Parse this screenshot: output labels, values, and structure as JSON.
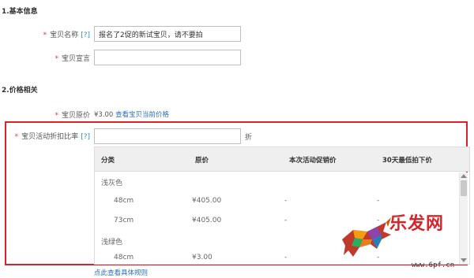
{
  "section1": {
    "title": "1.基本信息"
  },
  "fields": {
    "name": {
      "label": "宝贝名称",
      "help": "[?]",
      "value": "报名了2促的新试宝贝，请不要拍"
    },
    "slogan": {
      "label": "宝贝宣言",
      "value": ""
    }
  },
  "section2": {
    "title": "2.价格相关"
  },
  "price": {
    "label": "宝贝原价",
    "value": "¥3.00",
    "link": "查看宝贝当前价格"
  },
  "discount": {
    "label": "宝贝活动折扣比率",
    "help": "[?]",
    "value": "",
    "unit": "折"
  },
  "table": {
    "headers": [
      "分类",
      "原价",
      "本次活动促销价",
      "30天最低拍下价"
    ],
    "groups": [
      {
        "name": "浅灰色",
        "rows": [
          {
            "size": "48cm",
            "price": "¥405.00",
            "promo": "-",
            "low": "-"
          },
          {
            "size": "73cm",
            "price": "¥405.00",
            "promo": "-",
            "low": "-"
          }
        ]
      },
      {
        "name": "浅绿色",
        "rows": [
          {
            "size": "48cm",
            "price": "¥3.00",
            "promo": "-",
            "low": "-"
          }
        ]
      }
    ]
  },
  "rules_link": "点此查看具体规则",
  "required_mark": "*",
  "watermark": {
    "text": "乐发网",
    "url": "www.6pf.cn"
  },
  "colors": {
    "required": "#e4393c",
    "link": "#2a6fb8",
    "highlight_border": "#d9232b"
  }
}
